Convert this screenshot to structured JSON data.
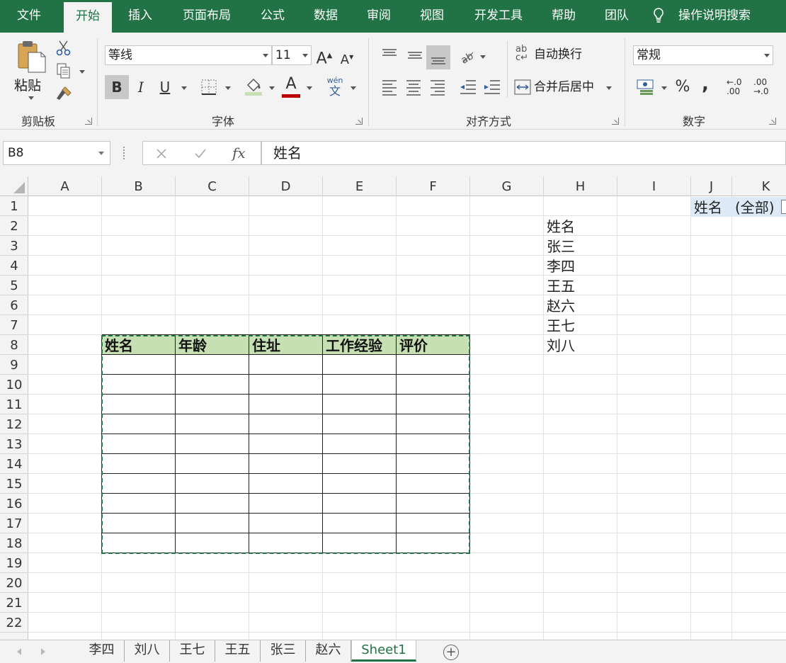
{
  "menu": {
    "file": "文件",
    "home": "开始",
    "insert": "插入",
    "layout": "页面布局",
    "formulas": "公式",
    "data": "数据",
    "review": "审阅",
    "view": "视图",
    "developer": "开发工具",
    "help": "帮助",
    "team": "团队",
    "tell_me": "操作说明搜索"
  },
  "ribbon": {
    "clipboard": {
      "paste_label": "粘贴",
      "group_label": "剪贴板"
    },
    "font": {
      "font_name": "等线",
      "font_size": "11",
      "bold": "B",
      "italic": "I",
      "underline": "U",
      "phonetic_top": "wén",
      "phonetic_bottom": "文",
      "font_color_glyph": "A",
      "group_label": "字体",
      "font_color": "#c00000",
      "fill_color": "#c6e0b4"
    },
    "alignment": {
      "wrap_text": "自动换行",
      "merge_center": "合并后居中",
      "group_label": "对齐方式",
      "wrap_icon_text": "ab"
    },
    "number": {
      "format": "常规",
      "percent": "%",
      "comma": ",",
      "inc_decimal_top": "←.0",
      "inc_decimal_bottom": ".00",
      "dec_decimal_top": ".00",
      "dec_decimal_bottom": "→.0",
      "group_label": "数字"
    }
  },
  "formula_bar": {
    "name_box": "B8",
    "fx": "fx",
    "content": "姓名"
  },
  "grid": {
    "columns": [
      "A",
      "B",
      "C",
      "D",
      "E",
      "F",
      "G",
      "H",
      "I",
      "J",
      "K"
    ],
    "rows": [
      "1",
      "2",
      "3",
      "4",
      "5",
      "6",
      "7",
      "8",
      "9",
      "10",
      "11",
      "12",
      "13",
      "14",
      "15",
      "16",
      "17",
      "18",
      "19",
      "20",
      "21",
      "22"
    ],
    "table_headers": [
      "姓名",
      "年龄",
      "住址",
      "工作经验",
      "评价"
    ],
    "h_column": [
      "姓名",
      "张三",
      "李四",
      "王五",
      "赵六",
      "王七",
      "刘八"
    ],
    "filter_label": "姓名",
    "filter_value": "(全部)",
    "header_fill": "#c6e0b4",
    "selection_border": "#217346"
  },
  "sheets": [
    "李四",
    "刘八",
    "王七",
    "王五",
    "张三",
    "赵六",
    "Sheet1"
  ],
  "active_sheet": "Sheet1",
  "add_sheet": "+"
}
